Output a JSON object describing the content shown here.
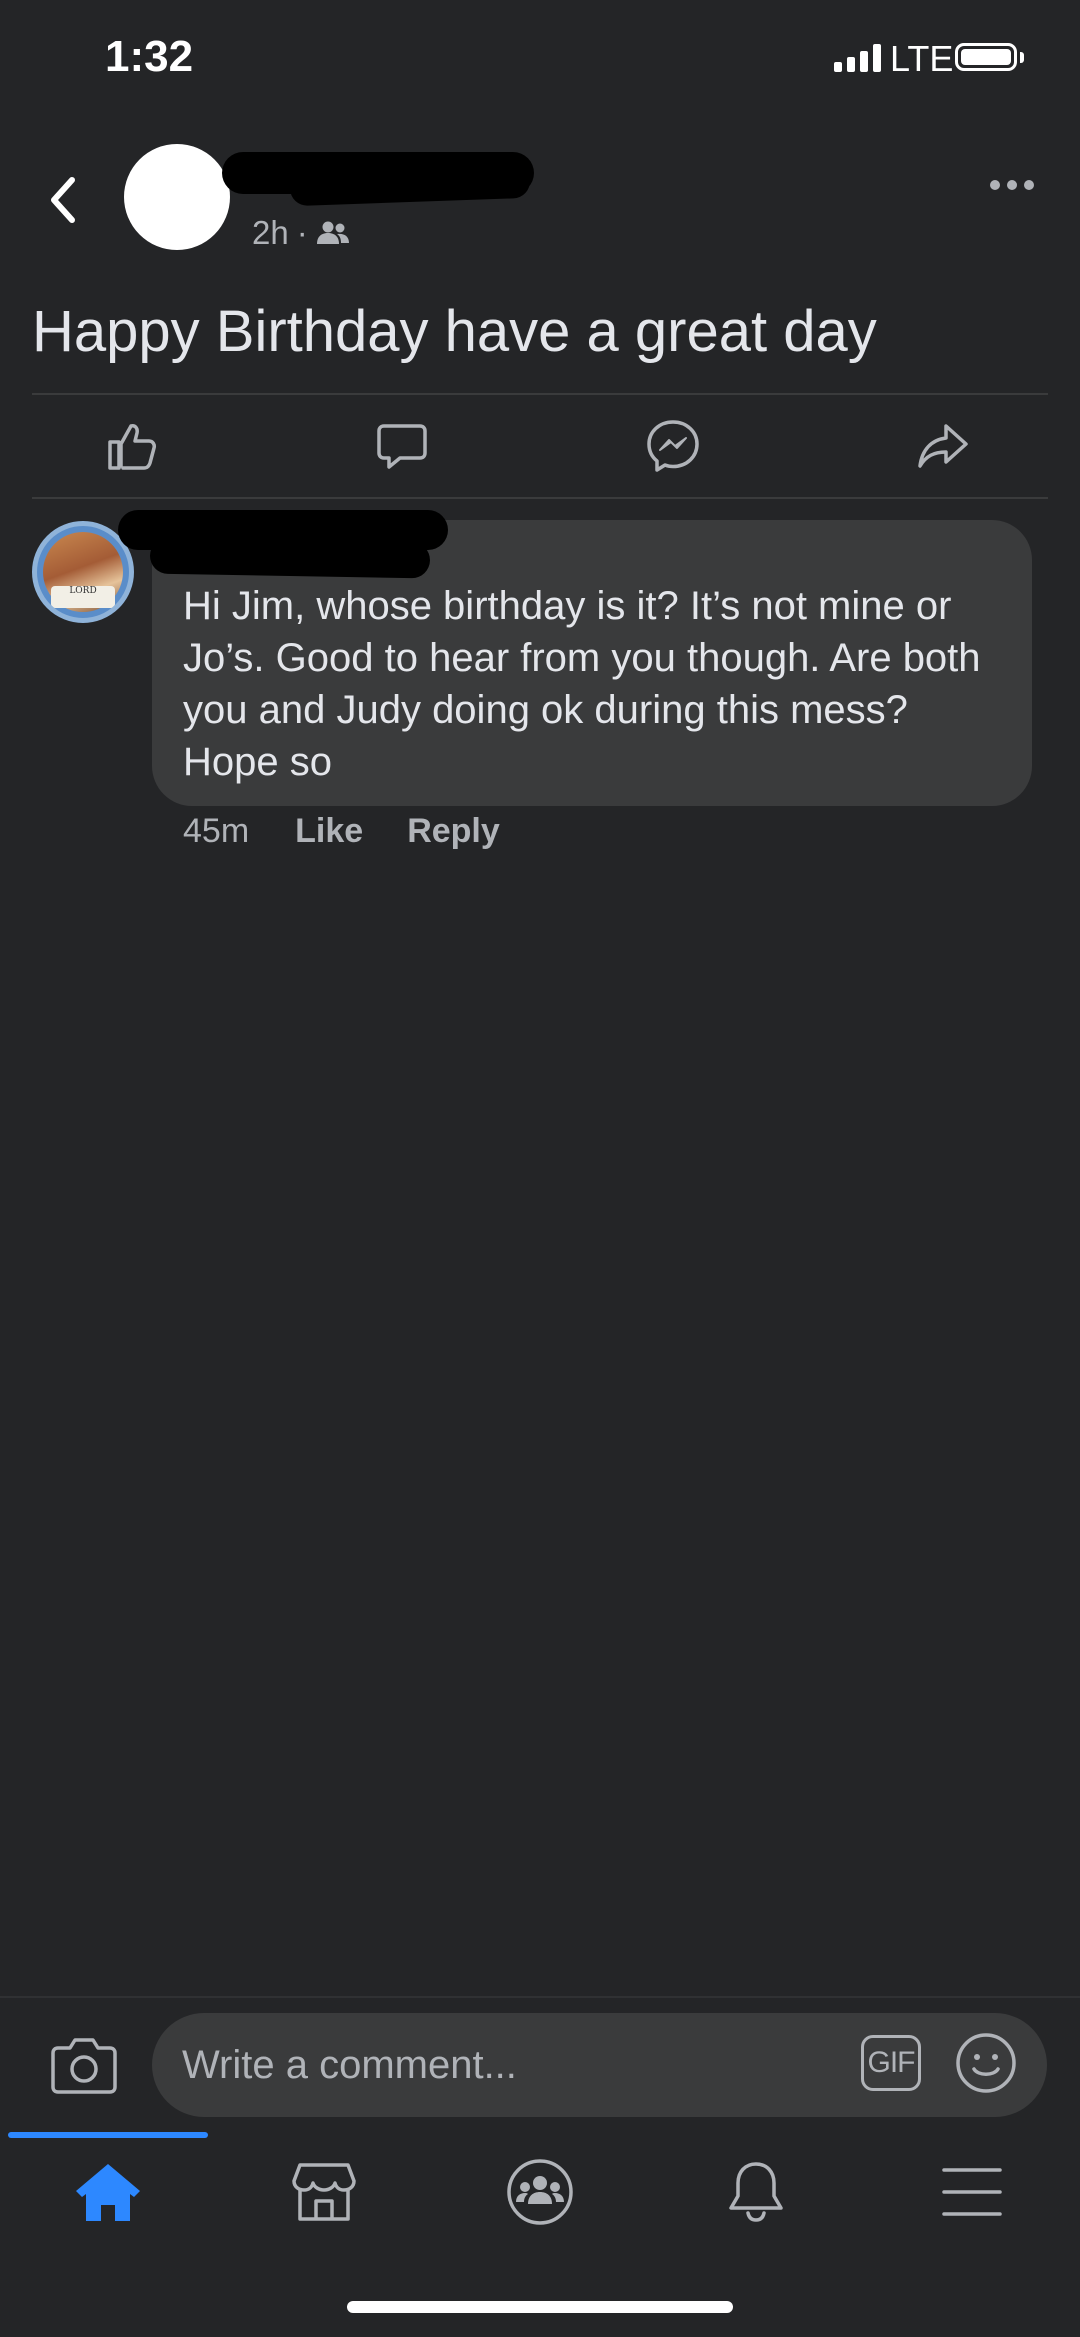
{
  "status": {
    "time": "1:32",
    "network": "LTE"
  },
  "post": {
    "time": "2h",
    "separator": "·",
    "text": "Happy Birthday have a great day"
  },
  "icons": {
    "back": "chevron-left-icon",
    "more": "more-icon",
    "audience": "friends-icon",
    "like": "thumbs-up-icon",
    "comment": "comment-icon",
    "messenger": "messenger-icon",
    "share": "share-icon",
    "camera": "camera-icon",
    "emoji": "emoji-icon",
    "home": "home-icon",
    "marketplace": "marketplace-icon",
    "groups": "groups-icon",
    "notifications": "bell-icon",
    "menu": "menu-icon"
  },
  "comment": {
    "text": "Hi Jim, whose birthday is it? It’s not mine or Jo’s. Good to hear from you though. Are both you and Judy doing ok during this mess? Hope so",
    "time": "45m",
    "like_label": "Like",
    "reply_label": "Reply",
    "avatar_badge": "LORD"
  },
  "composer": {
    "placeholder": "Write a comment...",
    "gif_label": "GIF"
  },
  "colors": {
    "background": "#242527",
    "bubble": "#3a3b3c",
    "accent": "#2d88ff",
    "secondary_text": "#b0b3b8"
  }
}
